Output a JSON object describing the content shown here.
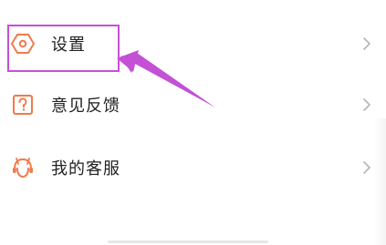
{
  "menu": {
    "items": [
      {
        "label": "设置",
        "icon": "settings-hexagon-icon",
        "chevron": "chevron-right-icon"
      },
      {
        "label": "意见反馈",
        "icon": "question-box-icon",
        "chevron": "chevron-right-icon"
      },
      {
        "label": "我的客服",
        "icon": "customer-service-icon",
        "chevron": "chevron-right-icon"
      }
    ]
  },
  "colors": {
    "icon_orange": "#f07a4a",
    "label_text": "#222222",
    "chevron_gray": "#b5b5b5",
    "annotation_magenta": "#c450d6"
  },
  "annotation": {
    "target": "settings",
    "style": "rectangle-with-arrow"
  }
}
